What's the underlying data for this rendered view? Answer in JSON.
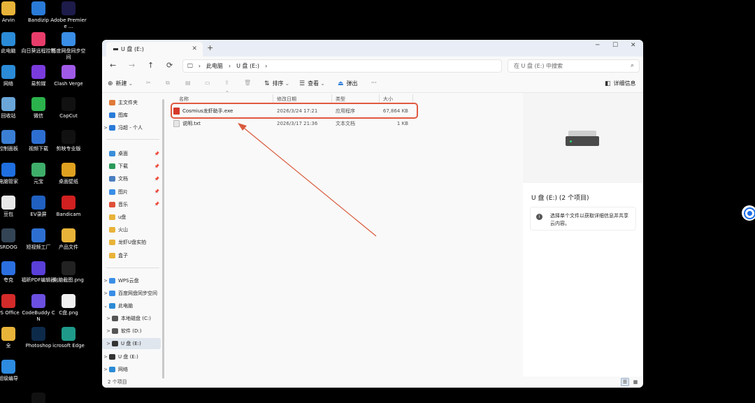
{
  "desktop": {
    "icons": [
      {
        "label": "Arvin",
        "icon": "folder-icon",
        "color": "#e8b339"
      },
      {
        "label": "Bandizip",
        "icon": "bandizip-icon",
        "color": "#2a7bd8"
      },
      {
        "label": "Adobe Premiere ...",
        "icon": "premiere-icon",
        "color": "#1d1b4a"
      },
      {
        "label": "此电脑",
        "icon": "computer-icon",
        "color": "#2b8bd6"
      },
      {
        "label": "向日葵远程控制",
        "icon": "sunflower-icon",
        "color": "#e83d6b"
      },
      {
        "label": "百度网盘同步空间",
        "icon": "baidu-sync-icon",
        "color": "#3a8ee6"
      },
      {
        "label": "网络",
        "icon": "network-icon",
        "color": "#2b8bd6"
      },
      {
        "label": "易剪媒",
        "icon": "yijianmei-icon",
        "color": "#7a3bdc"
      },
      {
        "label": "Clash Verge",
        "icon": "clash-icon",
        "color": "#a05ae8"
      },
      {
        "label": "回收站",
        "icon": "recycle-bin-icon",
        "color": "#6aa6d8"
      },
      {
        "label": "微信",
        "icon": "wechat-icon",
        "color": "#2bb24c"
      },
      {
        "label": "CapCut",
        "icon": "capcut-icon",
        "color": "#111111"
      },
      {
        "label": "控制面板",
        "icon": "control-panel-icon",
        "color": "#3b7fd4"
      },
      {
        "label": "视频下载",
        "icon": "video-download-icon",
        "color": "#2d6fd1"
      },
      {
        "label": "剪映专业版",
        "icon": "jianying-icon",
        "color": "#111111"
      },
      {
        "label": "电脑管家",
        "icon": "pc-manager-icon",
        "color": "#1f6fe0"
      },
      {
        "label": "元宝",
        "icon": "yuanbao-icon",
        "color": "#3fae6a"
      },
      {
        "label": "桌面壁纸",
        "icon": "wallpaper-icon",
        "color": "#e0a020"
      },
      {
        "label": "豆包",
        "icon": "doubao-icon",
        "color": "#e8e8e8"
      },
      {
        "label": "EV录屏",
        "icon": "ev-recorder-icon",
        "color": "#2060c0"
      },
      {
        "label": "Bandicam",
        "icon": "bandicam-icon",
        "color": "#d02020"
      },
      {
        "label": "SRDOG",
        "icon": "srdog-icon",
        "color": "#334455"
      },
      {
        "label": "短视频工厂",
        "icon": "video-factory-icon",
        "color": "#2d6fd1"
      },
      {
        "label": "产品文件",
        "icon": "folder-icon",
        "color": "#e8b339"
      },
      {
        "label": "夸克",
        "icon": "quark-icon",
        "color": "#2b6fe0"
      },
      {
        "label": "福昕PDF编辑器",
        "icon": "foxit-icon",
        "color": "#5a3fd8"
      },
      {
        "label": "电脑截图.png",
        "icon": "image-file-icon",
        "color": "#222222"
      },
      {
        "label": "PS Office",
        "icon": "wps-icon",
        "color": "#d42a2a"
      },
      {
        "label": "CodeBuddy CN",
        "icon": "codebuddy-icon",
        "color": "#6b4fe0"
      },
      {
        "label": "C盘.png",
        "icon": "image-file-icon",
        "color": "#f0f0f0"
      },
      {
        "label": "全",
        "icon": "folder-icon",
        "color": "#e8b339"
      },
      {
        "label": "Photoshop",
        "icon": "photoshop-icon",
        "color": "#0d2a4a"
      },
      {
        "label": "icrosoft Edge",
        "icon": "edge-icon",
        "color": "#1f9a8a"
      },
      {
        "label": "超级编导",
        "icon": "chaoji-biandao-icon",
        "color": "#2d8be0"
      }
    ]
  },
  "window": {
    "tab_title": "U 盘 (E:)",
    "new_tab": "+",
    "close_tab": "✕",
    "minimize": "─",
    "maximize": "☐",
    "close": "✕"
  },
  "nav": {
    "back": "←",
    "forward": "→",
    "up": "↑",
    "refresh": "⟳",
    "breadcrumb": [
      "此电脑",
      "U 盘 (E:)"
    ],
    "search_placeholder": "在 U 盘 (E:) 中搜索"
  },
  "toolbar": {
    "new": "新建",
    "sort": "排序",
    "view": "查看",
    "eject": "弹出",
    "more": "···",
    "details": "详细信息"
  },
  "sidebar": {
    "quick": [
      {
        "label": "主文件夹",
        "icon": "home-icon",
        "color": "#e07a3a"
      },
      {
        "label": "图库",
        "icon": "gallery-icon",
        "color": "#2a7bd8"
      },
      {
        "label": "冯超 - 个人",
        "icon": "onedrive-icon",
        "color": "#2a7bd8"
      }
    ],
    "pinned": [
      {
        "label": "桌面",
        "icon": "desktop-icon",
        "color": "#3b8fd9",
        "pinned": true
      },
      {
        "label": "下载",
        "icon": "download-icon",
        "color": "#2a9a5a",
        "pinned": true
      },
      {
        "label": "文档",
        "icon": "documents-icon",
        "color": "#4a7fc0",
        "pinned": true
      },
      {
        "label": "图片",
        "icon": "pictures-icon",
        "color": "#3a8ee6",
        "pinned": true
      },
      {
        "label": "音乐",
        "icon": "music-icon",
        "color": "#e0503a",
        "pinned": true
      },
      {
        "label": "u盘",
        "icon": "folder-icon",
        "color": "#e8b339",
        "pinned": false
      },
      {
        "label": "火山",
        "icon": "folder-icon",
        "color": "#e8b339",
        "pinned": false
      },
      {
        "label": "龙虾U盘实拍",
        "icon": "folder-icon",
        "color": "#e8b339",
        "pinned": false
      },
      {
        "label": "盒子",
        "icon": "folder-icon",
        "color": "#e8b339",
        "pinned": false
      }
    ],
    "tree": [
      {
        "label": "WPS云盘",
        "icon": "cloud-icon",
        "color": "#3a8ee6",
        "chev": ">"
      },
      {
        "label": "百度网盘同步空间",
        "icon": "baidu-sync-icon",
        "color": "#3a8ee6",
        "chev": ">"
      },
      {
        "label": "此电脑",
        "icon": "computer-icon",
        "color": "#2b8bd6",
        "chev": "⌄"
      },
      {
        "label": "本地磁盘 (C:)",
        "icon": "drive-icon",
        "color": "#555555",
        "chev": ">"
      },
      {
        "label": "软件 (D:)",
        "icon": "drive-icon",
        "color": "#555555",
        "chev": ">"
      },
      {
        "label": "U 盘 (E:)",
        "icon": "usb-drive-icon",
        "color": "#333333",
        "chev": ">"
      },
      {
        "label": "U 盘 (E:)",
        "icon": "usb-drive-icon",
        "color": "#333333",
        "chev": ">"
      },
      {
        "label": "网络",
        "icon": "network-icon",
        "color": "#2b8bd6",
        "chev": ">"
      }
    ]
  },
  "columns": {
    "name": "名称",
    "modified": "修改日期",
    "type": "类型",
    "size": "大小"
  },
  "files": [
    {
      "name": "Cosmius龙虾助手.exe",
      "modified": "2026/3/24 17:21",
      "type": "应用程序",
      "size": "67,864 KB",
      "icon": "exe-icon",
      "color": "#d63a2a"
    },
    {
      "name": "说明.txt",
      "modified": "2026/3/17 21:36",
      "type": "文本文档",
      "size": "1 KB",
      "icon": "txt-file-icon",
      "color": "#e6e6e6"
    }
  ],
  "details": {
    "title": "U 盘 (E:) (2 个项目)",
    "hint": "选择单个文件以获取详细信息并共享云内容。"
  },
  "status": {
    "count": "2 个项目"
  },
  "annotation_color": "#e05a40"
}
